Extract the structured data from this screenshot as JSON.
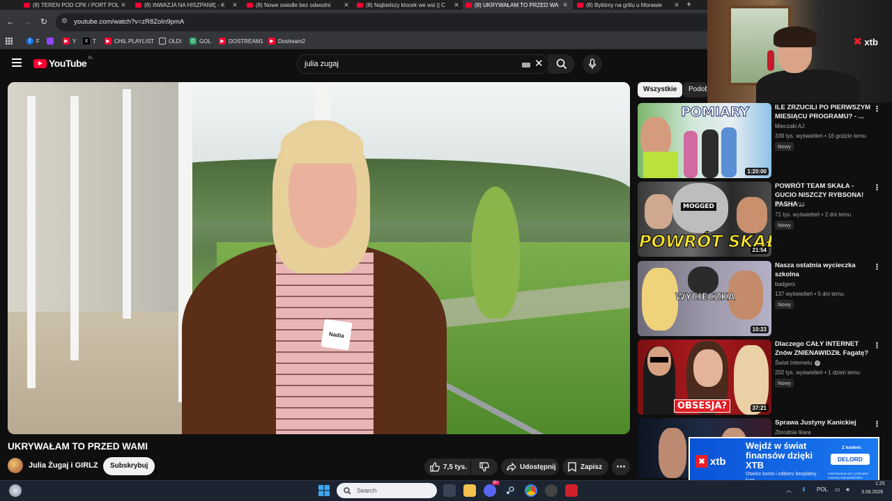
{
  "browser": {
    "tabs": [
      {
        "title": "(8) TEREN POD CPK / PORT POL",
        "active": false
      },
      {
        "title": "(8) INWAZJA NA HISZPANIĘ - K",
        "active": false
      },
      {
        "title": "(8) Nowe osiedle bez odwodni",
        "active": false
      },
      {
        "title": "(8) Najbielszy klocek we wsi || C",
        "active": false
      },
      {
        "title": "(8) UKRYWAŁAM TO PRZED WA",
        "active": true
      },
      {
        "title": "(8) Byliśmy na grillu u Morawie",
        "active": false
      }
    ],
    "new_tab": "+",
    "url": "youtube.com/watch?v=zR8ZoIn9pmA",
    "bookmarks": [
      {
        "label": "F",
        "icon": "facebook-icon",
        "color": "#1877f2"
      },
      {
        "label": "",
        "icon": "twitch-icon",
        "color": "#9146ff"
      },
      {
        "label": "Y",
        "icon": "youtube-icon",
        "color": "#ff0033"
      },
      {
        "label": "T",
        "icon": "x-icon",
        "color": "#000000"
      },
      {
        "label": "CHIL PLAYLIST",
        "icon": "youtube-icon",
        "color": "#ff0033"
      },
      {
        "label": "OLD\\",
        "icon": "folder-icon",
        "color": "#35363a"
      },
      {
        "label": "GOL",
        "icon": "g-icon",
        "color": "#2aa36a"
      },
      {
        "label": "DOSTREAM1",
        "icon": "youtube-icon",
        "color": "#ff0033"
      },
      {
        "label": "Dostream2",
        "icon": "youtube-icon",
        "color": "#ff0033"
      }
    ]
  },
  "youtube": {
    "logo_text": "YouTube",
    "region": "PL",
    "search_query": "julia zugaj",
    "video": {
      "title": "UKRYWAŁAM TO PRZED WAMI",
      "channel": "Julia Żugaj i GIRLZ",
      "subscribe_label": "Subskrybuj",
      "likes": "7,5 tys.",
      "share_label": "Udostępnij",
      "save_label": "Zapisz",
      "badge_text": "Nadia"
    },
    "chips": [
      {
        "label": "Wszystkie",
        "active": true
      },
      {
        "label": "Podob",
        "active": false
      }
    ],
    "recommendations": [
      {
        "title": "ILE ZRZUCILI PO PIERWSZYM MIESIĄCU PROGRAMU? - ...",
        "channel": "Mieczaki AJ",
        "meta": "339 tys. wyświetleń • 16 godzin temu",
        "badge": "Nowy",
        "duration": "1:20:00",
        "thumb_text": "POMIARY",
        "verified": false
      },
      {
        "title": "POWRÓT TEAM SKAŁA - GUCIO NISZCZY RYBSONA! PASHA ...",
        "channel": "SzklanaY2J",
        "meta": "71 tys. wyświetleń • 2 dni temu",
        "badge": "Nowy",
        "duration": "21:54",
        "thumb_text": "POWRÓT SKAŁ",
        "thumb_text2": "MOGGED",
        "verified": false
      },
      {
        "title": "Nasza ostatnia wycieczka szkolna",
        "channel": "badgers",
        "meta": "137 wyświetleń • 5 dni temu",
        "badge": "Nowy",
        "duration": "10:23",
        "thumb_text": "WYCIECZKA",
        "verified": false
      },
      {
        "title": "Dlaczego CAŁY INTERNET Znów ZNIENAWIDZIŁ Fagatę?",
        "channel": "Świat Internetu",
        "meta": "202 tys. wyświetleń • 1 dzień temu",
        "badge": "Nowy",
        "duration": "37:21",
        "thumb_text": "OBSESJA?",
        "verified": true
      },
      {
        "title": "Sprawa Justyny Kanickiej",
        "channel": "Zbrodnia Ikara",
        "meta": "",
        "badge": "",
        "duration": "",
        "thumb_text": "",
        "verified": false
      }
    ]
  },
  "overlay": {
    "xtb_logo": "xtb",
    "ad": {
      "headline": "Wejdź w świat finansów dzięki XTB",
      "subline": "Otwórz konto i odbierz bezpłatny kurs",
      "code_label": "Z kodem:",
      "code": "DELORD",
      "fine_print": "Inwestowanie jest ryzykowne. Inwestuj odpowiedzialnie."
    }
  },
  "taskbar": {
    "search_placeholder": "Search",
    "language": "POL",
    "time": "1:25",
    "date": "3.08.2026",
    "discord_badge": "9+"
  },
  "colors": {
    "youtube_red": "#ff0033",
    "background": "#0f0f0f",
    "xtb_blue": "#0a52d6",
    "xtb_red": "#e8202a"
  }
}
